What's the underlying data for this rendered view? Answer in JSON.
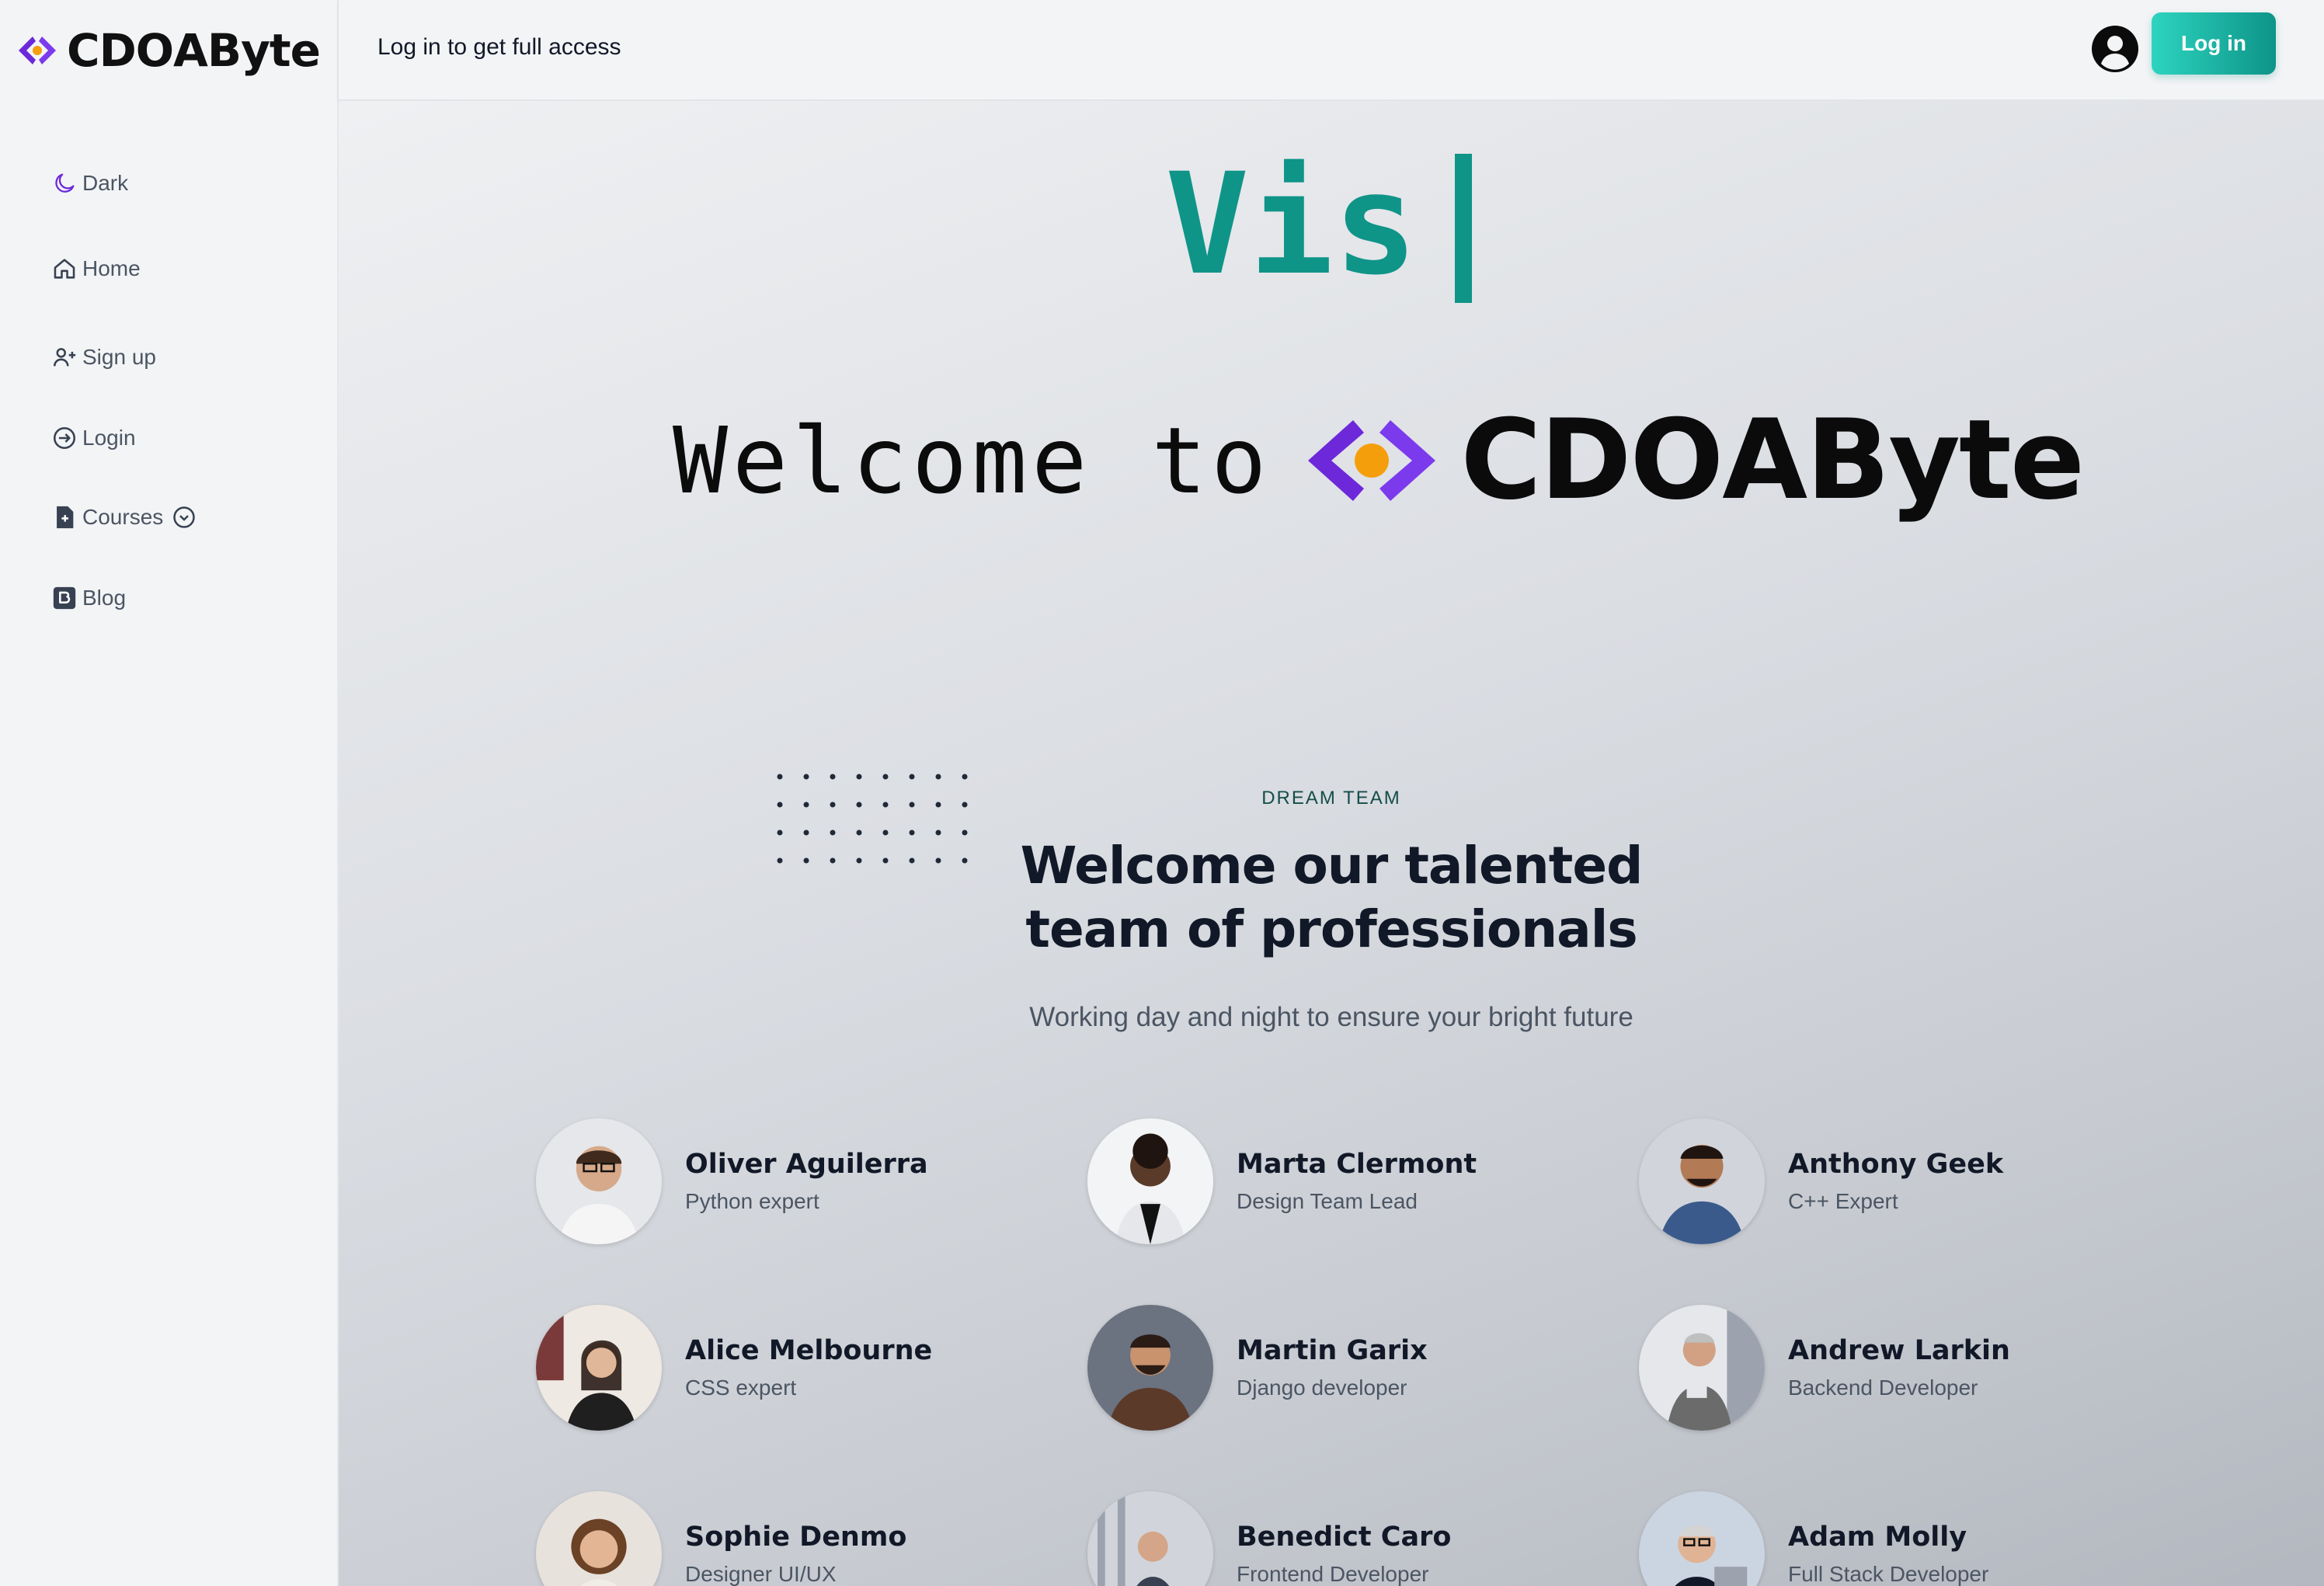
{
  "brand": {
    "name": "CDOΑByte"
  },
  "sidebar": {
    "items": [
      {
        "label": "Dark",
        "icon": "moon-icon"
      },
      {
        "label": "Home",
        "icon": "home-icon"
      },
      {
        "label": "Sign up",
        "icon": "user-plus-icon"
      },
      {
        "label": "Login",
        "icon": "login-icon"
      },
      {
        "label": "Courses",
        "icon": "file-plus-icon"
      },
      {
        "label": "Blog",
        "icon": "blog-icon"
      }
    ]
  },
  "topbar": {
    "message": "Log in to get full access",
    "login_label": "Log in"
  },
  "hero": {
    "typing_text": "Vis",
    "welcome_text": "Welcome to",
    "brand_word": "CDOΑByte"
  },
  "team": {
    "eyebrow": "DREAM TEAM",
    "heading": "Welcome our talented team of professionals",
    "subheading": "Working day and night to ensure your bright future",
    "members": [
      {
        "name": "Oliver Aguilerra",
        "role": "Python expert"
      },
      {
        "name": "Marta Clermont",
        "role": "Design Team Lead"
      },
      {
        "name": "Anthony Geek",
        "role": "C++ Expert"
      },
      {
        "name": "Alice Melbourne",
        "role": "CSS expert"
      },
      {
        "name": "Martin Garix",
        "role": "Django developer"
      },
      {
        "name": "Andrew Larkin",
        "role": "Backend Developer"
      },
      {
        "name": "Sophie Denmo",
        "role": "Designer UI/UX"
      },
      {
        "name": "Benedict Caro",
        "role": "Frontend Developer"
      },
      {
        "name": "Adam Molly",
        "role": "Full Stack Developer"
      }
    ]
  },
  "colors": {
    "accent": "#0f9488",
    "brand_purple": "#6d28d9",
    "brand_orange": "#f59e0b"
  }
}
